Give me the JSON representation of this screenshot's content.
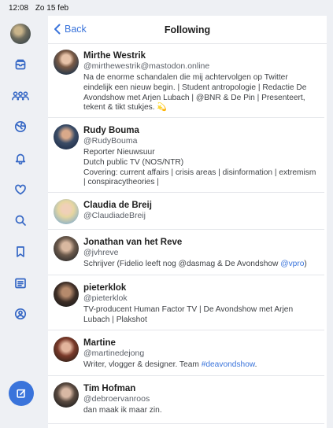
{
  "status_bar": {
    "time": "12:08",
    "date": "Zo 15 feb"
  },
  "sidebar": {
    "icons": [
      "home-icon",
      "inbox-icon",
      "people-icon",
      "globe-icon",
      "bell-icon",
      "heart-icon",
      "search-icon",
      "bookmark-icon",
      "list-icon",
      "profile-icon"
    ],
    "compose_icon": "compose-icon"
  },
  "header": {
    "back_label": "Back",
    "title": "Following"
  },
  "accounts": [
    {
      "name": "Mirthe Westrik",
      "handle": "@mirthewestrik@mastodon.online",
      "bio": "Na de enorme schandalen die mij achtervolgen op Twitter\neindelijk een nieuw begin. | Student antropologie | Redactie De\nAvondshow met Arjen Lubach | @BNR & De Pin | Presenteert,\ntekent & tikt stukjes. 💫"
    },
    {
      "name": "Rudy Bouma",
      "handle": "@RudyBouma",
      "bio": "Reporter Nieuwsuur\nDutch public TV (NOS/NTR)\nCovering: current affairs | crisis areas | disinformation | extremism\n| conspiracytheories |"
    },
    {
      "name": "Claudia de Breij",
      "handle": "@ClaudiadeBreij",
      "bio": ""
    },
    {
      "name": "Jonathan van het Reve",
      "handle": "@jvhreve",
      "bio_prefix": "Schrijver (Fidelio leeft nog @dasmag & De Avondshow ",
      "bio_link": "@vpro",
      "bio_suffix": ")"
    },
    {
      "name": "pieterklok",
      "handle": "@pieterklok",
      "bio": "TV-producent Human Factor TV | De Avondshow met Arjen\nLubach | Plakshot"
    },
    {
      "name": "Martine",
      "handle": "@martinedejong",
      "bio_prefix": "Writer, vlogger & designer. Team ",
      "bio_link": "#deavondshow",
      "bio_suffix": "."
    },
    {
      "name": "Tim Hofman",
      "handle": "@debroervanroos",
      "bio": "dan maak ik maar zin."
    }
  ]
}
